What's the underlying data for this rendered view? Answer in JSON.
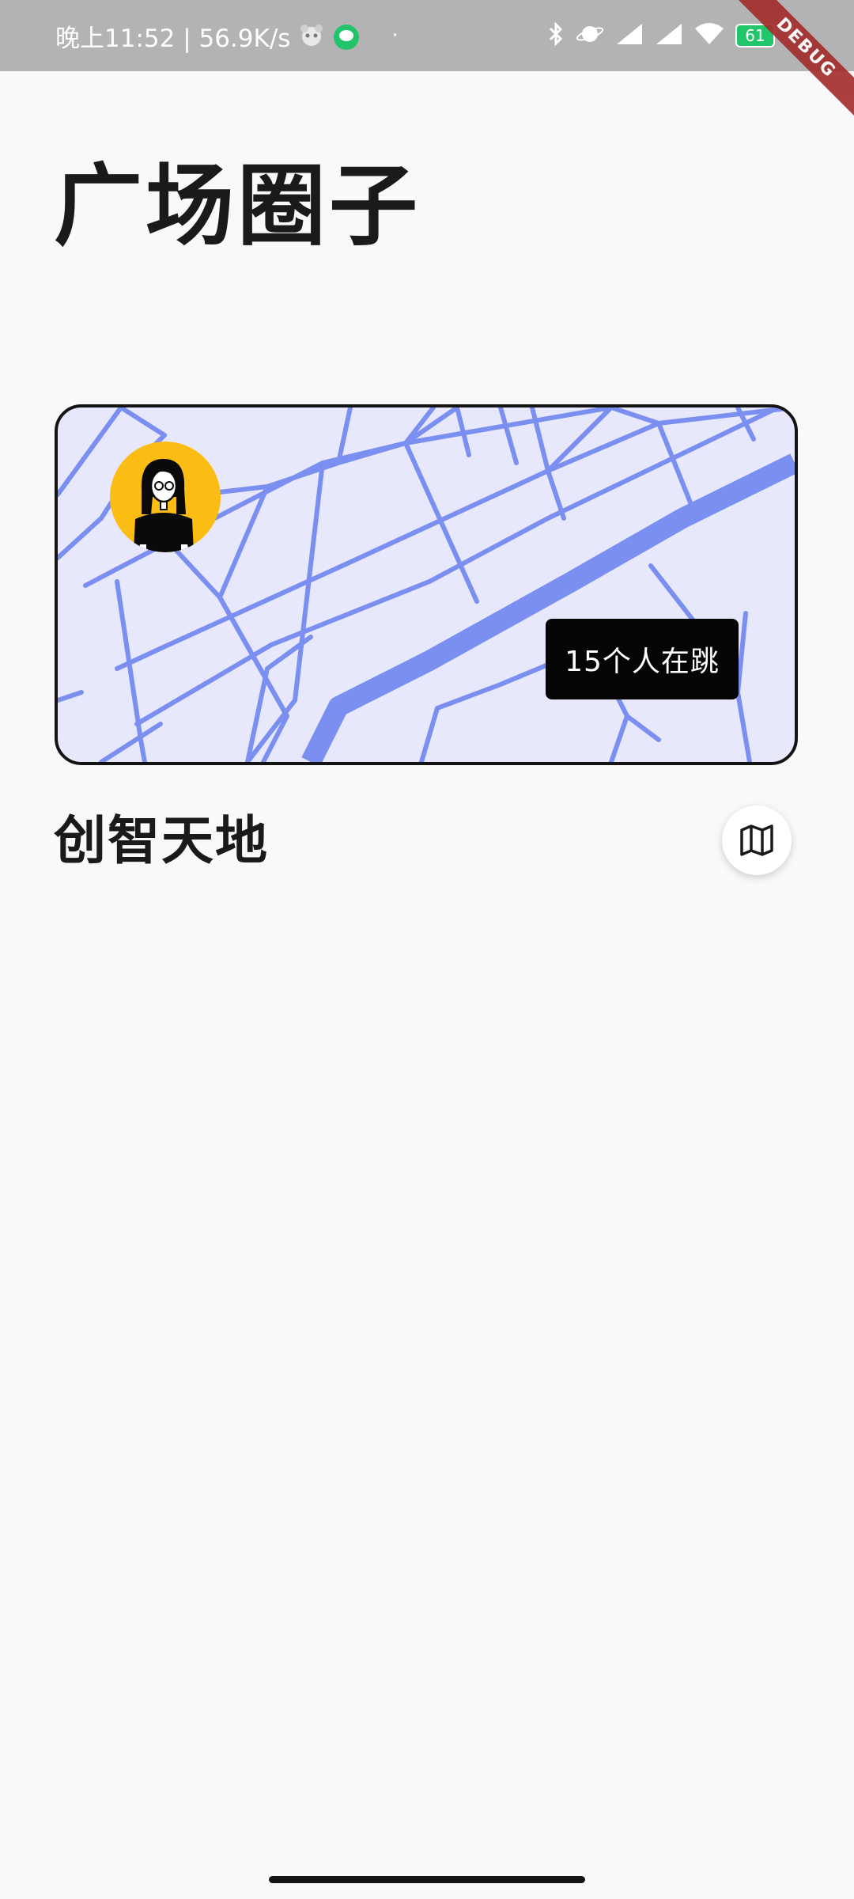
{
  "status_bar": {
    "time_speed": "晚上11:52 | 56.9K/s",
    "battery_level": "61",
    "icons": [
      "panda-icon",
      "message-app-icon",
      "dot-icon",
      "bluetooth-icon",
      "planet-icon",
      "signal-icon",
      "signal-icon",
      "wifi-icon",
      "battery-icon",
      "charging-icon"
    ]
  },
  "debug_banner": "DEBUG",
  "header": {
    "title": "广场圈子"
  },
  "map_card": {
    "tooltip": "15个人在跳",
    "avatar": "user-avatar",
    "colors": {
      "background": "#e8e8fc",
      "roads": "#7b8ff0",
      "avatar_bg": "#fbbd13"
    }
  },
  "section": {
    "title": "创智天地",
    "map_button_icon": "map-icon"
  }
}
